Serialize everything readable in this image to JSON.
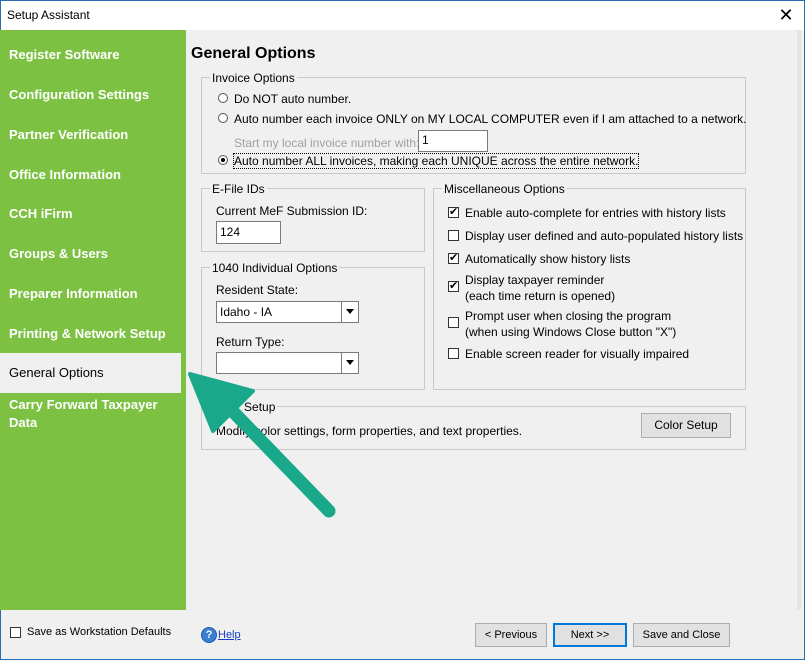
{
  "window": {
    "title": "Setup Assistant",
    "close_glyph": "✕"
  },
  "sidebar": {
    "items": [
      {
        "label": "Register Software"
      },
      {
        "label": "Configuration Settings"
      },
      {
        "label": "Partner Verification"
      },
      {
        "label": "Office Information"
      },
      {
        "label": "CCH iFirm"
      },
      {
        "label": "Groups & Users"
      },
      {
        "label": "Preparer Information"
      },
      {
        "label": "Printing & Network Setup"
      },
      {
        "label": "General Options",
        "active": true
      },
      {
        "label": "Carry Forward Taxpayer Data"
      }
    ]
  },
  "page": {
    "title": "General Options"
  },
  "invoice_options": {
    "label": "Invoice Options",
    "option1": "Do NOT auto number.",
    "option2": "Auto number each invoice ONLY on MY LOCAL COMPUTER even if I am attached to a network.",
    "start_label": "Start my local invoice number with:",
    "start_value": "1",
    "option3": "Auto number ALL invoices, making each UNIQUE across the entire network.",
    "selected": 3
  },
  "efile": {
    "label": "E-File IDs",
    "mef_label": "Current MeF Submission ID:",
    "mef_value": "124"
  },
  "individual": {
    "label": "1040 Individual Options",
    "state_label": "Resident State:",
    "state_value": "Idaho - IA",
    "return_type_label": "Return Type:",
    "return_type_value": ""
  },
  "misc": {
    "label": "Miscellaneous Options",
    "items": [
      {
        "line1": "Enable auto-complete for entries with history lists",
        "line2": "",
        "checked": true
      },
      {
        "line1": "Display user defined and auto-populated history lists",
        "line2": "",
        "checked": false
      },
      {
        "line1": "Automatically show history lists",
        "line2": "",
        "checked": true
      },
      {
        "line1": "Display taxpayer reminder",
        "line2": "(each time return is opened)",
        "checked": true
      },
      {
        "line1": "Prompt user when closing the program",
        "line2": "(when using Windows Close button \"X\")",
        "checked": false
      },
      {
        "line1": "Enable screen reader for visually impaired",
        "line2": "",
        "checked": false
      }
    ]
  },
  "color_setup": {
    "label": "Color Setup",
    "description": "Modify color settings, form properties, and text properties.",
    "button": "Color Setup"
  },
  "footer": {
    "save_defaults": "Save as Workstation Defaults",
    "help": "Help",
    "previous": "< Previous",
    "next": "Next >>",
    "save_close": "Save and Close"
  },
  "colors": {
    "sidebar_green": "#7dc143",
    "arrow_teal": "#1aa88a"
  },
  "icons": {
    "check_glyph": "✔",
    "help_glyph": "?"
  }
}
